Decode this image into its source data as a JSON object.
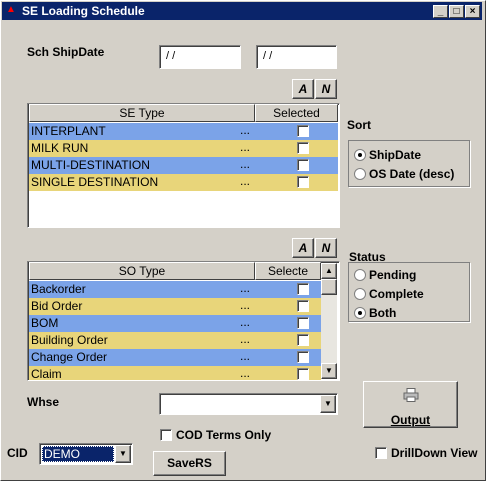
{
  "window": {
    "title": "SE Loading Schedule",
    "minimize": "_",
    "maximize": "□",
    "close": "×"
  },
  "ship_date": {
    "label": "Sch ShipDate",
    "from_value": "/ /",
    "to_value": "/ /"
  },
  "se_grid": {
    "btn_all": "A",
    "btn_none": "N",
    "col_type": "SE Type",
    "col_selected": "Selected",
    "rows": [
      {
        "label": "INTERPLANT",
        "dots": "...",
        "color": "#7ba3e8"
      },
      {
        "label": "MILK RUN",
        "dots": "...",
        "color": "#e8d57a"
      },
      {
        "label": "MULTI-DESTINATION",
        "dots": "...",
        "color": "#7ba3e8"
      },
      {
        "label": "SINGLE DESTINATION",
        "dots": "...",
        "color": "#e8d57a"
      }
    ]
  },
  "so_grid": {
    "btn_all": "A",
    "btn_none": "N",
    "col_type": "SO Type",
    "col_selected": "Selecte",
    "rows": [
      {
        "label": "Backorder",
        "dots": "...",
        "color": "#7ba3e8"
      },
      {
        "label": "Bid Order",
        "dots": "...",
        "color": "#e8d57a"
      },
      {
        "label": "BOM",
        "dots": "...",
        "color": "#7ba3e8"
      },
      {
        "label": "Building Order",
        "dots": "...",
        "color": "#e8d57a"
      },
      {
        "label": "Change Order",
        "dots": "...",
        "color": "#7ba3e8"
      },
      {
        "label": "Claim",
        "dots": "...",
        "color": "#e8d57a"
      }
    ]
  },
  "sort": {
    "label": "Sort",
    "options": [
      "ShipDate",
      "OS Date (desc)"
    ],
    "selected": "ShipDate"
  },
  "status": {
    "label": "Status",
    "options": [
      "Pending",
      "Complete",
      "Both"
    ],
    "selected": "Both"
  },
  "whse": {
    "label": "Whse",
    "value": ""
  },
  "cod_terms_only": {
    "label": "COD Terms Only",
    "checked": false
  },
  "cid": {
    "label": "CID",
    "value": "DEMO"
  },
  "buttons": {
    "output": "Output",
    "savers": "SaveRS"
  },
  "drilldown": {
    "label": "DrillDown View",
    "checked": false
  },
  "colors": {
    "blue_row": "#7ba3e8",
    "yellow_row": "#e8d57a",
    "title_bar": "#0a246a"
  }
}
